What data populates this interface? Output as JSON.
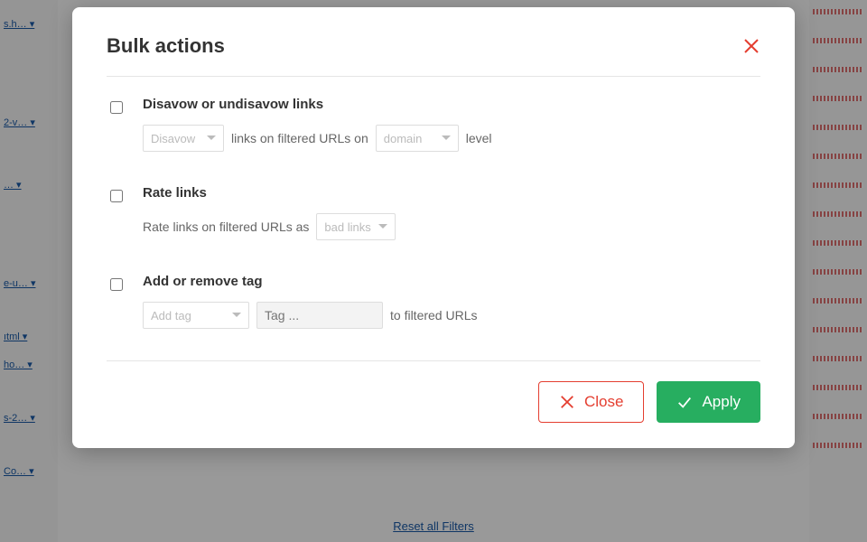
{
  "modal": {
    "title": "Bulk actions",
    "sections": {
      "disavow": {
        "title": "Disavow or undisavow links",
        "action_select": "Disavow",
        "text1": "links on filtered URLs on",
        "level_select": "domain",
        "text2": "level"
      },
      "rate": {
        "title": "Rate links",
        "text1": "Rate links on filtered URLs as",
        "rating_select": "bad links"
      },
      "tag": {
        "title": "Add or remove tag",
        "action_select": "Add tag",
        "tag_input_placeholder": "Tag ...",
        "text1": "to filtered URLs"
      }
    },
    "buttons": {
      "close": "Close",
      "apply": "Apply"
    }
  },
  "background": {
    "reset_filters": "Reset all Filters"
  }
}
